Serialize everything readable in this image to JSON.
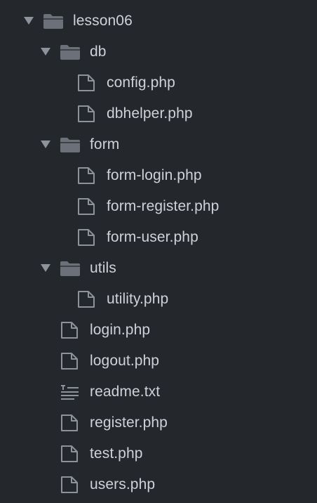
{
  "file_tree": {
    "root": {
      "name": "lesson06",
      "icon": "folder-icon",
      "expanded": true
    },
    "folders": [
      {
        "name": "db",
        "icon": "folder-icon",
        "expanded": true,
        "files": [
          {
            "name": "config.php",
            "icon": "file-icon"
          },
          {
            "name": "dbhelper.php",
            "icon": "file-icon"
          }
        ]
      },
      {
        "name": "form",
        "icon": "folder-icon",
        "expanded": true,
        "files": [
          {
            "name": "form-login.php",
            "icon": "file-icon"
          },
          {
            "name": "form-register.php",
            "icon": "file-icon"
          },
          {
            "name": "form-user.php",
            "icon": "file-icon"
          }
        ]
      },
      {
        "name": "utils",
        "icon": "folder-icon",
        "expanded": true,
        "files": [
          {
            "name": "utility.php",
            "icon": "file-icon"
          }
        ]
      }
    ],
    "files": [
      {
        "name": "login.php",
        "icon": "file-icon"
      },
      {
        "name": "logout.php",
        "icon": "file-icon"
      },
      {
        "name": "readme.txt",
        "icon": "text-file-icon"
      },
      {
        "name": "register.php",
        "icon": "file-icon"
      },
      {
        "name": "test.php",
        "icon": "file-icon"
      },
      {
        "name": "users.php",
        "icon": "file-icon"
      }
    ]
  },
  "colors": {
    "background": "#24272b",
    "text": "#cfd2d8",
    "icon": "#8e929a",
    "folder": "#6c7079"
  }
}
